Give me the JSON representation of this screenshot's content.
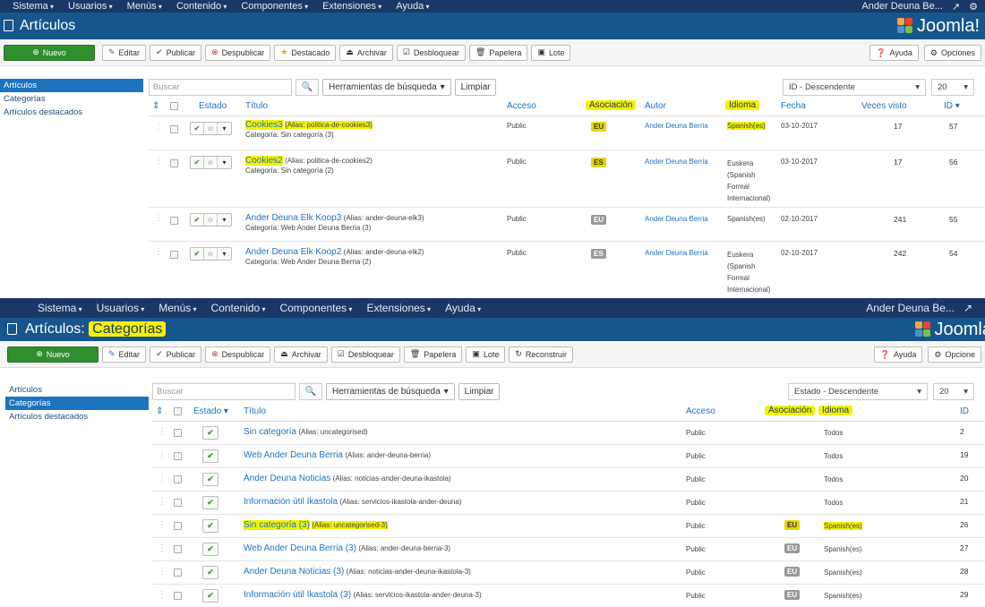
{
  "topnav": {
    "items": [
      "Sistema",
      "Usuarios",
      "Menús",
      "Contenido",
      "Componentes",
      "Extensiones",
      "Ayuda"
    ],
    "user": "Ander Deuna Be...",
    "user2": "Ander Deuna Be..."
  },
  "panel1": {
    "title": "Artículos",
    "logo": "Joomla!",
    "toolbar": {
      "new": "Nuevo",
      "edit": "Editar",
      "publish": "Publicar",
      "unpublish": "Despublicar",
      "feature": "Destacado",
      "archive": "Archivar",
      "checkin": "Desbloquear",
      "trash": "Papelera",
      "batch": "Lote",
      "help": "Ayuda",
      "options": "Opciones"
    },
    "sidebar": [
      "Artículos",
      "Categorías",
      "Artículos destacados"
    ],
    "search": {
      "placeholder": "Buscar",
      "tools": "Herramientas de búsqueda",
      "clear": "Limpiar"
    },
    "sort": "ID - Descendente",
    "limit": "20",
    "columns": {
      "estado": "Estado",
      "titulo": "Título",
      "acceso": "Acceso",
      "asociacion": "Asociación",
      "autor": "Autor",
      "idioma": "Idioma",
      "fecha": "Fecha",
      "visto": "Veces visto",
      "id": "ID"
    },
    "rows": [
      {
        "title": "Cookies3",
        "alias": "(Alias: politica-de-cookies3)",
        "cat": "Categoría: Sin categoría (3)",
        "access": "Public",
        "assoc": "EU",
        "author": "Ander Deuna Berria",
        "lang": "Spanish(es)",
        "date": "03-10-2017",
        "hits": "17",
        "id": "57"
      },
      {
        "title": "Cookies2",
        "alias": "(Alias: politica-de-cookies2)",
        "cat": "Categoría: Sin categoría (2)",
        "access": "Public",
        "assoc": "ES",
        "author": "Ander Deuna Berria",
        "lang": "Euskera (Spanish Formal Internacional)",
        "date": "03-10-2017",
        "hits": "17",
        "id": "56"
      },
      {
        "title": "Ander Deuna Elk Koop3",
        "alias": "(Alias: ander-deuna-elk3)",
        "cat": "Categoría: Web Ander Deuna Berria (3)",
        "access": "Public",
        "assoc": "EU",
        "author": "Ander Deuna Berria",
        "lang": "Spanish(es)",
        "date": "02-10-2017",
        "hits": "241",
        "id": "55"
      },
      {
        "title": "Ander Deuna Elk Koop2",
        "alias": "(Alias: ander-deuna-elk2)",
        "cat": "Categoría: Web Ander Deuna Berria (2)",
        "access": "Public",
        "assoc": "ES",
        "author": "Ander Deuna Berria",
        "lang": "Euskera (Spanish Formal Internacional)",
        "date": "02-10-2017",
        "hits": "242",
        "id": "54"
      }
    ]
  },
  "panel2": {
    "title_a": "Artículos: ",
    "title_b": "Categorías",
    "logo": "Joomla",
    "toolbar": {
      "new": "Nuevo",
      "edit": "Editar",
      "publish": "Publicar",
      "unpublish": "Despublicar",
      "archive": "Archivar",
      "checkin": "Desbloquear",
      "trash": "Papelera",
      "batch": "Lote",
      "rebuild": "Reconstruir",
      "help": "Ayuda",
      "options": "Opcione"
    },
    "sidebar": [
      "Artículos",
      "Categorías",
      "Artículos destacados"
    ],
    "search": {
      "placeholder": "Buscar",
      "tools": "Herramientas de búsqueda",
      "clear": "Limpiar"
    },
    "sort": "Estado - Descendente",
    "limit": "20",
    "columns": {
      "estado": "Estado",
      "titulo": "Título",
      "acceso": "Acceso",
      "asociacion": "Asociación",
      "idioma": "Idioma",
      "id": "ID"
    },
    "rows": [
      {
        "title": "Sin categoría",
        "alias": "(Alias: uncategorised)",
        "access": "Public",
        "assoc": "",
        "lang": "Todos",
        "id": "2"
      },
      {
        "title": "Web Ander Deuna Berria",
        "alias": "(Alias: ander-deuna-berria)",
        "access": "Public",
        "assoc": "",
        "lang": "Todos",
        "id": "19"
      },
      {
        "title": "Ander Deuna Noticias",
        "alias": "(Alias: noticias-ander-deuna-ikastola)",
        "access": "Public",
        "assoc": "",
        "lang": "Todos",
        "id": "20"
      },
      {
        "title": "Información útil Ikastola",
        "alias": "(Alias: servicios-ikastola-ander-deuna)",
        "access": "Public",
        "assoc": "",
        "lang": "Todos",
        "id": "21"
      },
      {
        "title": "Sin categoría (3)",
        "alias": "(Alias: uncategorised-3)",
        "access": "Public",
        "assoc": "EU",
        "lang": "Spanish(es)",
        "id": "26"
      },
      {
        "title": "Web Ander Deuna Berria (3)",
        "alias": "(Alias: ander-deuna-berria-3)",
        "access": "Public",
        "assoc": "EU",
        "lang": "Spanish(es)",
        "id": "27"
      },
      {
        "title": "Ander Deuna Noticias (3)",
        "alias": "(Alias: noticias-ander-deuna-ikastola-3)",
        "access": "Public",
        "assoc": "EU",
        "lang": "Spanish(es)",
        "id": "28"
      },
      {
        "title": "Información útil Ikastola (3)",
        "alias": "(Alias: servicios-ikastola-ander-deuna-3)",
        "access": "Public",
        "assoc": "EU",
        "lang": "Spanish(es)",
        "id": "29"
      }
    ]
  }
}
